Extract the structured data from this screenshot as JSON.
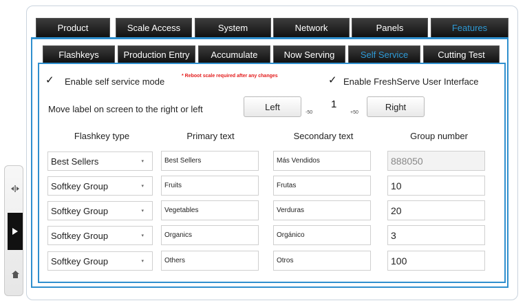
{
  "side_nav": {
    "icons": [
      "split-arrows-icon",
      "play-icon",
      "home-icon"
    ]
  },
  "tabs_top": [
    "Product",
    "Scale Access",
    "System",
    "Network",
    "Panels",
    "Features"
  ],
  "tabs_sub": [
    "Flashkeys",
    "Production Entry",
    "Accumulate",
    "Now Serving",
    "Self Service",
    "Cutting Test"
  ],
  "options": {
    "enable_self_service": {
      "label": "Enable self service mode",
      "checked": true,
      "check": "✓"
    },
    "reboot_note": "* Reboot scale required after any changes",
    "enable_freshserve": {
      "label": "Enable FreshServe User Interface",
      "checked": true,
      "check": "✓"
    }
  },
  "move_label": {
    "label": "Move label on screen to the right or left",
    "left_button": "Left",
    "min": "-50",
    "value": "1",
    "max": "+50",
    "right_button": "Right"
  },
  "columns": [
    "Flashkey type",
    "Primary text",
    "Secondary text",
    "Group number"
  ],
  "rows": [
    {
      "type": "Best Sellers",
      "primary": "Best Sellers",
      "secondary": "Más Vendidos",
      "group": "888050"
    },
    {
      "type": "Softkey Group",
      "primary": "Fruits",
      "secondary": "Frutas",
      "group": "10"
    },
    {
      "type": "Softkey Group",
      "primary": "Vegetables",
      "secondary": "Verduras",
      "group": "20"
    },
    {
      "type": "Softkey Group",
      "primary": "Organics",
      "secondary": "Orgánico",
      "group": "3"
    },
    {
      "type": "Softkey Group",
      "primary": "Others",
      "secondary": "Otros",
      "group": "100"
    }
  ],
  "dropdown_arrow": "▾",
  "colors": {
    "accent": "#2f8fce",
    "active_tab_text": "#2e9ad6",
    "note": "#e31b1b"
  }
}
